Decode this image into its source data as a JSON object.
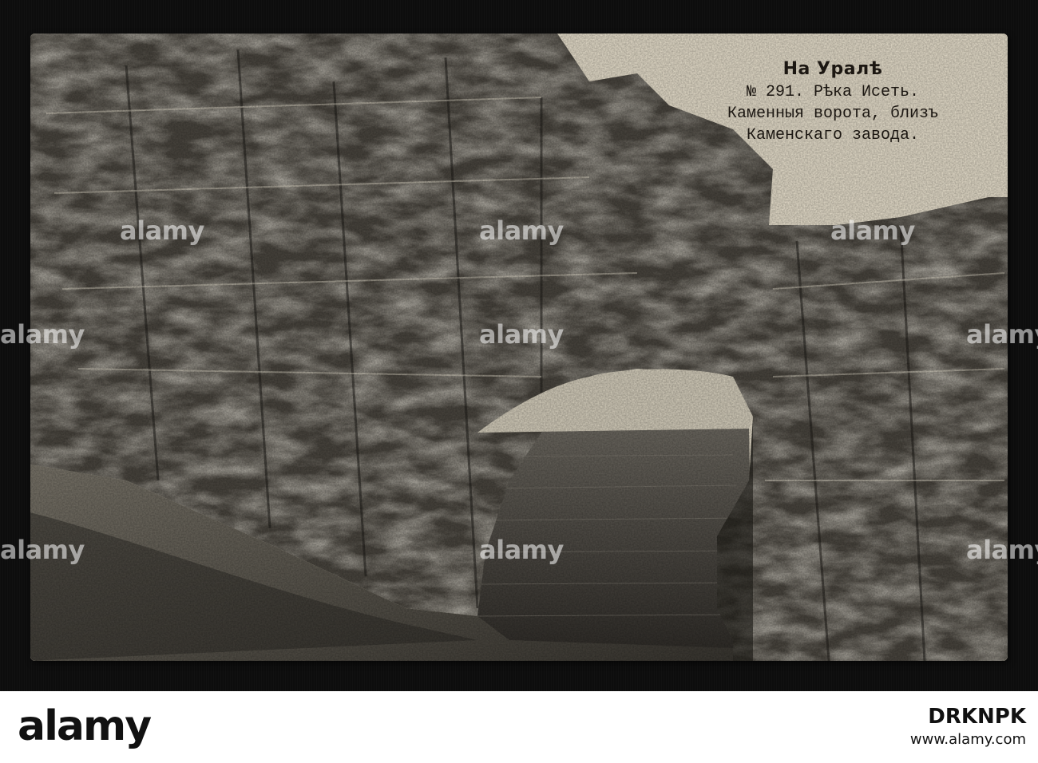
{
  "caption": {
    "title": "На Уралѣ",
    "line1": "№ 291.  Рѣка Исеть.",
    "line2": "Каменныя ворота, близъ",
    "line3": "Каменскаго завода."
  },
  "watermark": "alamy",
  "footer": {
    "logo": "alamy",
    "image_id": "DRKNPK",
    "url": "www.alamy.com"
  }
}
